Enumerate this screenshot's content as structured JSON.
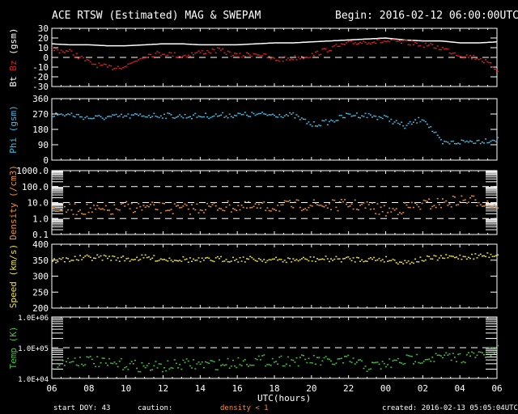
{
  "title": "ACE RTSW (Estimated) MAG & SWEPAM",
  "begin": "Begin: 2016-02-12 06:00:00UTC",
  "footer": {
    "start_doy": "start DOY:  43",
    "caution": "caution:",
    "density_note": "density < 1",
    "created": "created: 2016-02-13 05:05:04UTC"
  },
  "chart_data": {
    "type": "scatter",
    "xlabel": "UTC(hours)",
    "x_ticks": [
      "06",
      "08",
      "10",
      "12",
      "14",
      "16",
      "18",
      "20",
      "22",
      "00",
      "02",
      "04",
      "06"
    ],
    "x_hours": [
      0,
      1,
      2,
      3,
      4,
      5,
      6,
      7,
      8,
      9,
      10,
      11,
      12,
      13,
      14,
      15,
      16,
      17,
      18,
      19,
      20,
      21,
      22,
      23,
      24
    ],
    "panels": [
      {
        "id": "mag",
        "ylabel_parts": [
          "Bt",
          "Bz",
          "(gsm)"
        ],
        "scale": "linear",
        "ylim": [
          -30,
          30
        ],
        "ticks": [
          "30",
          "20",
          "10",
          "0",
          "-10",
          "-20",
          "-30"
        ],
        "tick_values": [
          30,
          20,
          10,
          0,
          -10,
          -20,
          -30
        ],
        "dashed": [
          0
        ],
        "series": [
          {
            "name": "Bt",
            "color": "#ffffff",
            "line": true,
            "values": [
              14,
              13,
              13,
              12,
              12,
              13,
              14,
              14,
              13,
              13,
              13,
              14,
              15,
              15,
              16,
              17,
              18,
              19,
              20,
              18,
              17,
              17,
              15,
              15,
              16
            ]
          },
          {
            "name": "Bz",
            "color": "#d42020",
            "values": [
              9,
              6,
              -5,
              -10,
              -8,
              3,
              5,
              2,
              6,
              8,
              2,
              5,
              -2,
              0,
              3,
              10,
              15,
              17,
              17,
              16,
              14,
              10,
              3,
              0,
              -12
            ]
          }
        ]
      },
      {
        "id": "phi",
        "ylabel_parts": [
          "Phi (gsm)"
        ],
        "scale": "linear",
        "ylim": [
          0,
          360
        ],
        "ticks": [
          "360",
          "270",
          "180",
          "90",
          "0"
        ],
        "tick_values": [
          360,
          270,
          180,
          90,
          0
        ],
        "dashed": [],
        "series": [
          {
            "name": "Phi",
            "color": "#40b8e0",
            "values": [
              270,
              270,
              250,
              255,
              260,
              265,
              265,
              260,
              262,
              265,
              268,
              270,
              270,
              265,
              210,
              230,
              270,
              265,
              250,
              200,
              250,
              100,
              110,
              115,
              125
            ]
          }
        ]
      },
      {
        "id": "density",
        "ylabel_parts": [
          "Density (/cm3)"
        ],
        "scale": "log",
        "ylim": [
          0.1,
          1000
        ],
        "ticks": [
          "1000.0",
          "100.0",
          "10.0",
          "1.0",
          "0.1"
        ],
        "tick_values": [
          1000,
          100,
          10,
          1,
          0.1
        ],
        "dashed": [
          100,
          10,
          1
        ],
        "series": [
          {
            "name": "Density",
            "color": "#e89030",
            "values": [
              5,
              4,
              4,
              3,
              6,
              5,
              5,
              4,
              5,
              6,
              6,
              5,
              6,
              7,
              8,
              7,
              8,
              6,
              3,
              5,
              8,
              10,
              15,
              14,
              7
            ]
          }
        ]
      },
      {
        "id": "speed",
        "ylabel_parts": [
          "Speed (km/s)"
        ],
        "scale": "linear",
        "ylim": [
          200,
          400
        ],
        "ticks": [
          "400",
          "350",
          "300",
          "250",
          "200"
        ],
        "tick_values": [
          400,
          350,
          300,
          250,
          200
        ],
        "dashed": [],
        "series": [
          {
            "name": "Speed",
            "color": "#e8e040",
            "values": [
              350,
              355,
              360,
              360,
              355,
              360,
              355,
              355,
              350,
              355,
              355,
              355,
              352,
              352,
              355,
              355,
              355,
              355,
              355,
              345,
              355,
              360,
              362,
              365,
              370
            ]
          }
        ]
      },
      {
        "id": "temp",
        "ylabel_parts": [
          "Temp (K)"
        ],
        "scale": "log",
        "ylim": [
          10000,
          1000000
        ],
        "ticks": [
          "1.0E+06",
          "1.0E+05",
          "1.0E+04"
        ],
        "tick_values": [
          1000000,
          100000,
          10000
        ],
        "dashed": [
          100000
        ],
        "series": [
          {
            "name": "Temp",
            "color": "#40c040",
            "values": [
              30000,
              40000,
              40000,
              30000,
              30000,
              25000,
              25000,
              30000,
              30000,
              30000,
              35000,
              40000,
              40000,
              40000,
              40000,
              35000,
              40000,
              25000,
              30000,
              40000,
              50000,
              50000,
              50000,
              60000,
              80000
            ]
          }
        ]
      }
    ]
  }
}
